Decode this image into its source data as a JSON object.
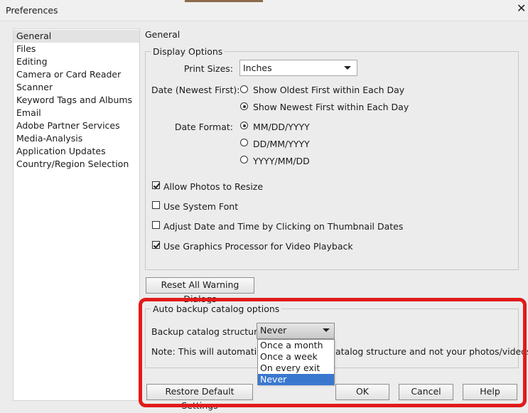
{
  "window": {
    "title": "Preferences",
    "close_glyph": "✕"
  },
  "sidebar": {
    "items": [
      {
        "label": "General",
        "selected": true
      },
      {
        "label": "Files"
      },
      {
        "label": "Editing"
      },
      {
        "label": "Camera or Card Reader"
      },
      {
        "label": "Scanner"
      },
      {
        "label": "Keyword Tags and Albums"
      },
      {
        "label": "Email"
      },
      {
        "label": "Adobe Partner Services"
      },
      {
        "label": "Media-Analysis"
      },
      {
        "label": "Application Updates"
      },
      {
        "label": "Country/Region Selection"
      }
    ]
  },
  "main": {
    "title": "General",
    "display_options": {
      "legend": "Display Options",
      "print_sizes_label": "Print Sizes:",
      "print_sizes_value": "Inches",
      "date_label": "Date (Newest First):",
      "date_options": [
        {
          "label": "Show Oldest First within Each Day",
          "checked": false
        },
        {
          "label": "Show Newest First within Each Day",
          "checked": true
        }
      ],
      "date_format_label": "Date Format:",
      "date_format_options": [
        {
          "label": "MM/DD/YYYY",
          "checked": true
        },
        {
          "label": "DD/MM/YYYY",
          "checked": false
        },
        {
          "label": "YYYY/MM/DD",
          "checked": false
        }
      ],
      "checkboxes": [
        {
          "label": "Allow Photos to Resize",
          "checked": true
        },
        {
          "label": "Use System Font",
          "checked": false
        },
        {
          "label": "Adjust Date and Time by Clicking on Thumbnail Dates",
          "checked": false
        },
        {
          "label": "Use Graphics Processor for Video Playback",
          "checked": true
        }
      ]
    },
    "reset_warnings_button": "Reset All Warning Dialogs",
    "auto_backup": {
      "legend": "Auto backup catalog options",
      "structure_label": "Backup catalog structure",
      "structure_value": "Never",
      "note_start": "Note: This will automatica",
      "note_end": "atalog structure and not your photos/videos.",
      "dropdown_options": [
        {
          "label": "Once a month"
        },
        {
          "label": "Once a week"
        },
        {
          "label": "On every exit"
        },
        {
          "label": "Never",
          "selected": true
        }
      ]
    }
  },
  "footer": {
    "restore_button": "Restore Default Settings",
    "ok_button": "OK",
    "cancel_button": "Cancel",
    "help_button": "Help"
  },
  "colors": {
    "highlight_box": "#e21a1a",
    "selection": "#3a78d0",
    "dialog_bg": "#ececec"
  }
}
